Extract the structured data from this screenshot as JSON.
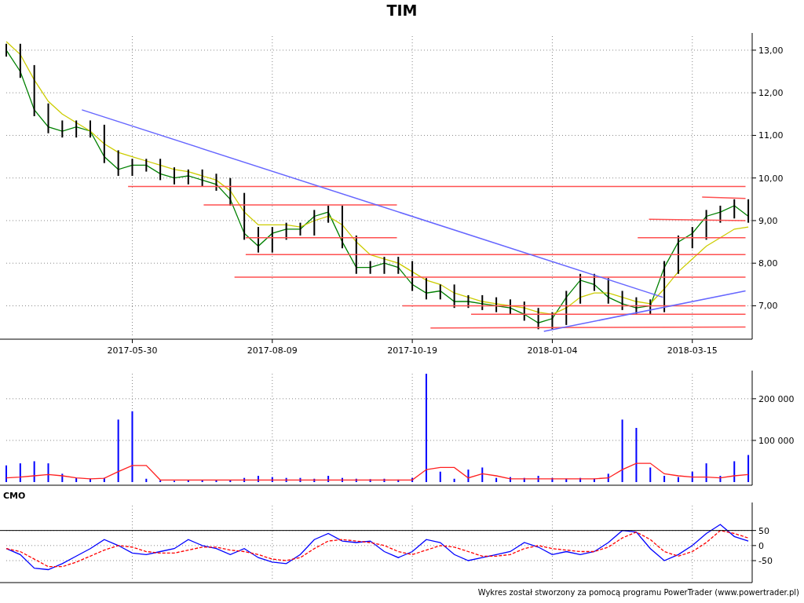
{
  "title": "TIM",
  "price_panel": {
    "chart_data": {
      "type": "line",
      "grid": true,
      "categories": [
        null,
        null,
        null,
        null,
        null,
        null,
        null,
        null,
        null,
        "2017-05-30",
        null,
        null,
        null,
        null,
        null,
        null,
        null,
        null,
        null,
        "2017-08-09",
        null,
        null,
        null,
        null,
        null,
        null,
        null,
        null,
        null,
        "2017-10-19",
        null,
        null,
        null,
        null,
        null,
        null,
        null,
        null,
        null,
        "2018-01-04",
        null,
        null,
        null,
        null,
        null,
        null,
        null,
        null,
        null,
        "2018-03-15",
        null,
        null,
        null,
        null
      ],
      "ylim": [
        6.29,
        13.33
      ],
      "yticks": [
        {
          "value": 7,
          "label": "7,00"
        },
        {
          "value": 8,
          "label": "8,00"
        },
        {
          "value": 9,
          "label": "9,00"
        },
        {
          "value": 10,
          "label": "10,00"
        },
        {
          "value": 11,
          "label": "11,00"
        },
        {
          "value": 12,
          "label": "12,00"
        },
        {
          "value": 13,
          "label": "13,00"
        }
      ],
      "series": [
        {
          "color": "#008000",
          "values": [
            13.0,
            12.5,
            11.6,
            11.2,
            11.1,
            11.2,
            11.1,
            10.5,
            10.2,
            10.3,
            10.3,
            10.1,
            10.0,
            10.05,
            9.95,
            9.85,
            9.5,
            8.7,
            8.4,
            8.7,
            8.8,
            8.8,
            9.1,
            9.2,
            8.5,
            7.9,
            7.9,
            8.0,
            7.9,
            7.5,
            7.3,
            7.35,
            7.1,
            7.1,
            7.05,
            7.0,
            6.95,
            6.8,
            6.6,
            6.7,
            7.2,
            7.6,
            7.5,
            7.2,
            7.05,
            6.95,
            7.0,
            7.9,
            8.5,
            8.7,
            9.1,
            9.2,
            9.35,
            9.1
          ]
        },
        {
          "color": "#cccc00",
          "values": [
            13.2,
            12.9,
            12.3,
            11.8,
            11.5,
            11.3,
            11.1,
            10.8,
            10.6,
            10.5,
            10.4,
            10.3,
            10.2,
            10.15,
            10.05,
            9.95,
            9.7,
            9.2,
            8.9,
            8.9,
            8.9,
            8.85,
            9.0,
            9.1,
            8.9,
            8.5,
            8.2,
            8.1,
            8.0,
            7.8,
            7.6,
            7.5,
            7.3,
            7.2,
            7.1,
            7.05,
            7.0,
            6.95,
            6.85,
            6.8,
            6.95,
            7.2,
            7.3,
            7.3,
            7.2,
            7.1,
            7.05,
            7.4,
            7.8,
            8.1,
            8.4,
            8.6,
            8.8,
            8.85
          ]
        }
      ]
    }
  },
  "volume_panel": {
    "chart_data": {
      "type": "bar",
      "grid": true,
      "ylim": [
        0,
        260000
      ],
      "categories": [
        null,
        null,
        null,
        null,
        null,
        null,
        null,
        null,
        null,
        null,
        null,
        null,
        null,
        null,
        null,
        null,
        null,
        null,
        null,
        null,
        null,
        null,
        null,
        null,
        null,
        null,
        null,
        null,
        null,
        null,
        null,
        null,
        null,
        null,
        null,
        null,
        null,
        null,
        null,
        null,
        null,
        null,
        null,
        null,
        null,
        null,
        null,
        null,
        null,
        null,
        null,
        null,
        null,
        null
      ],
      "yticks": [
        {
          "value": 100000,
          "label": "100 000"
        },
        {
          "value": 200000,
          "label": "200 000"
        }
      ],
      "series": [
        {
          "color": "#0000ff",
          "values": [
            40000,
            45000,
            50000,
            45000,
            20000,
            10000,
            8000,
            10000,
            150000,
            170000,
            8000,
            4000,
            3000,
            4000,
            5000,
            4000,
            5000,
            10000,
            15000,
            12000,
            10000,
            10000,
            8000,
            15000,
            10000,
            8000,
            7000,
            8000,
            6000,
            10000,
            260000,
            25000,
            8000,
            30000,
            35000,
            10000,
            12000,
            10000,
            15000,
            10000,
            8000,
            10000,
            8000,
            20000,
            150000,
            130000,
            35000,
            15000,
            12000,
            25000,
            45000,
            15000,
            50000,
            65000
          ]
        },
        {
          "type": "line",
          "color": "#ff2020",
          "values": [
            10000,
            12000,
            15000,
            18000,
            15000,
            10000,
            8000,
            9000,
            25000,
            40000,
            40000,
            5000,
            5000,
            5000,
            5000,
            5000,
            5000,
            5000,
            5000,
            5000,
            5000,
            5000,
            5000,
            5000,
            5000,
            5000,
            5000,
            5000,
            5000,
            5000,
            30000,
            35000,
            35000,
            10000,
            20000,
            15000,
            8000,
            8000,
            8000,
            8000,
            8000,
            8000,
            8000,
            10000,
            30000,
            45000,
            45000,
            20000,
            15000,
            12000,
            12000,
            10000,
            15000,
            18000
          ]
        }
      ]
    }
  },
  "cmo_panel": {
    "label": "CMO",
    "chart_data": {
      "type": "line",
      "grid": true,
      "categories": [
        null,
        null,
        null,
        null,
        null,
        null,
        null,
        null,
        null,
        null,
        null,
        null,
        null,
        null,
        null,
        null,
        null,
        null,
        null,
        null,
        null,
        null,
        null,
        null,
        null,
        null,
        null,
        null,
        null,
        null,
        null,
        null,
        null,
        null,
        null,
        null,
        null,
        null,
        null,
        null,
        null,
        null,
        null,
        null,
        null,
        null,
        null,
        null,
        null,
        null,
        null,
        null,
        null,
        null
      ],
      "ylim": [
        -112.5,
        132.5
      ],
      "yticks": [
        {
          "value": -50,
          "label": "-50"
        },
        {
          "value": 0,
          "label": "0"
        },
        {
          "value": 50,
          "label": "50"
        }
      ],
      "series": [
        {
          "color": "#0000ff",
          "values": [
            -10,
            -30,
            -75,
            -80,
            -60,
            -35,
            -10,
            20,
            0,
            -25,
            -30,
            -20,
            -10,
            20,
            0,
            -10,
            -30,
            -10,
            -40,
            -55,
            -60,
            -30,
            20,
            40,
            15,
            10,
            15,
            -20,
            -40,
            -20,
            20,
            10,
            -30,
            -50,
            -40,
            -30,
            -20,
            10,
            -5,
            -30,
            -20,
            -30,
            -20,
            10,
            50,
            45,
            -10,
            -50,
            -30,
            0,
            40,
            70,
            30,
            15
          ]
        },
        {
          "color": "#ff0000",
          "line_style": "dashed",
          "values": [
            -10,
            -20,
            -45,
            -70,
            -70,
            -55,
            -35,
            -15,
            0,
            -5,
            -20,
            -25,
            -25,
            -15,
            -5,
            -5,
            -15,
            -20,
            -30,
            -45,
            -50,
            -40,
            -10,
            15,
            20,
            15,
            10,
            0,
            -20,
            -30,
            -15,
            0,
            -5,
            -20,
            -35,
            -35,
            -30,
            -10,
            0,
            -10,
            -15,
            -20,
            -20,
            -5,
            25,
            45,
            20,
            -20,
            -35,
            -20,
            10,
            50,
            40,
            25
          ]
        }
      ]
    }
  },
  "footer": "Wykres został stworzony za pomocą programu PowerTrader (www.powertrader.pl)"
}
